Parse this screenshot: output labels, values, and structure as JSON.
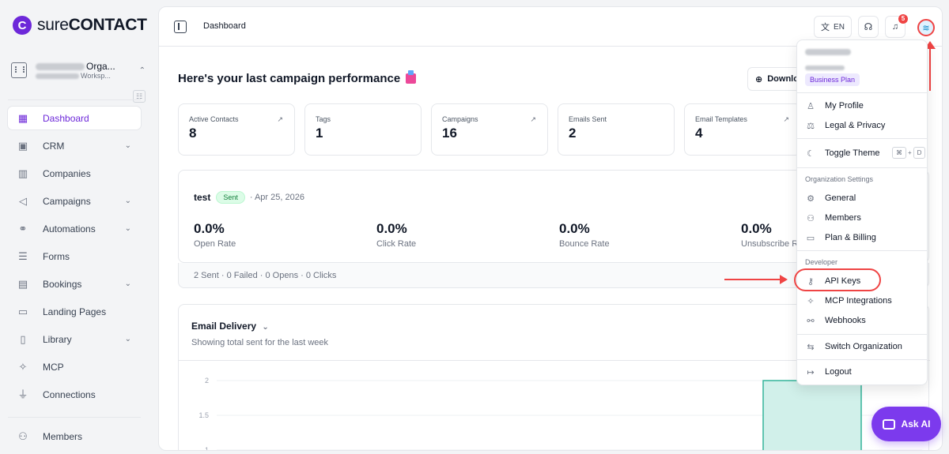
{
  "brand": {
    "mark": "C",
    "name_light": "sure",
    "name_bold": "CONTACT"
  },
  "org": {
    "name": "Orga...",
    "workspace": "Worksp..."
  },
  "sidebar": {
    "items": [
      {
        "label": "Dashboard",
        "icon": "grid-icon"
      },
      {
        "label": "CRM",
        "icon": "contact-card-icon"
      },
      {
        "label": "Companies",
        "icon": "building-icon"
      },
      {
        "label": "Campaigns",
        "icon": "megaphone-icon"
      },
      {
        "label": "Automations",
        "icon": "flow-icon"
      },
      {
        "label": "Forms",
        "icon": "form-icon"
      },
      {
        "label": "Bookings",
        "icon": "calendar-icon"
      },
      {
        "label": "Landing Pages",
        "icon": "layout-icon"
      },
      {
        "label": "Library",
        "icon": "library-icon"
      },
      {
        "label": "MCP",
        "icon": "mcp-icon"
      },
      {
        "label": "Connections",
        "icon": "plug-icon"
      }
    ],
    "bottom": {
      "label": "Members",
      "icon": "users-icon"
    }
  },
  "topbar": {
    "breadcrumb": "Dashboard",
    "lang": "EN",
    "notif_count": "5"
  },
  "main": {
    "heading": "Here's your last campaign performance",
    "download_label": "Downlo",
    "stats": [
      {
        "label": "Active Contacts",
        "value": "8",
        "arrow": true
      },
      {
        "label": "Tags",
        "value": "1",
        "arrow": false
      },
      {
        "label": "Campaigns",
        "value": "16",
        "arrow": true
      },
      {
        "label": "Emails Sent",
        "value": "2",
        "arrow": false
      },
      {
        "label": "Email Templates",
        "value": "4",
        "arrow": true
      }
    ],
    "campaign": {
      "name": "test",
      "status": "Sent",
      "date": "· Apr 25, 2026",
      "metrics": [
        {
          "value": "0.0%",
          "label": "Open Rate"
        },
        {
          "value": "0.0%",
          "label": "Click Rate"
        },
        {
          "value": "0.0%",
          "label": "Bounce Rate"
        },
        {
          "value": "0.0%",
          "label": "Unsubscribe R"
        }
      ],
      "footer": "2 Sent · 0 Failed · 0 Opens · 0 Clicks"
    },
    "delivery": {
      "title": "Email Delivery",
      "subtitle": "Showing total sent for the last week"
    }
  },
  "chart_data": {
    "type": "bar",
    "title": "Email Delivery",
    "xlabel": "",
    "ylabel": "",
    "y_ticks": [
      "2",
      "1.5",
      "1"
    ],
    "ylim": [
      1,
      2
    ],
    "values": [
      2
    ],
    "bar_color": "#d1f0ea",
    "bar_border": "#34b49a"
  },
  "dropdown": {
    "plan": "Business Plan",
    "items_top": [
      {
        "label": "My Profile",
        "icon": "user-icon"
      },
      {
        "label": "Legal & Privacy",
        "icon": "scale-icon"
      }
    ],
    "theme": {
      "label": "Toggle Theme",
      "icon": "moon-icon",
      "key1": "⌘",
      "plus": "+",
      "key2": "D"
    },
    "org_section": "Organization Settings",
    "org_items": [
      {
        "label": "General",
        "icon": "gear-icon"
      },
      {
        "label": "Members",
        "icon": "users-icon"
      },
      {
        "label": "Plan & Billing",
        "icon": "credit-card-icon"
      }
    ],
    "dev_section": "Developer",
    "dev_items": [
      {
        "label": "API Keys",
        "icon": "key-icon"
      },
      {
        "label": "MCP Integrations",
        "icon": "mcp-icon"
      },
      {
        "label": "Webhooks",
        "icon": "webhook-icon"
      }
    ],
    "switch": {
      "label": "Switch Organization",
      "icon": "swap-icon"
    },
    "logout": {
      "label": "Logout",
      "icon": "logout-icon"
    }
  },
  "ask_ai": {
    "label": "Ask AI"
  },
  "colors": {
    "accent": "#6d28d9",
    "annotation": "#ef4444",
    "success": "#15803d"
  }
}
